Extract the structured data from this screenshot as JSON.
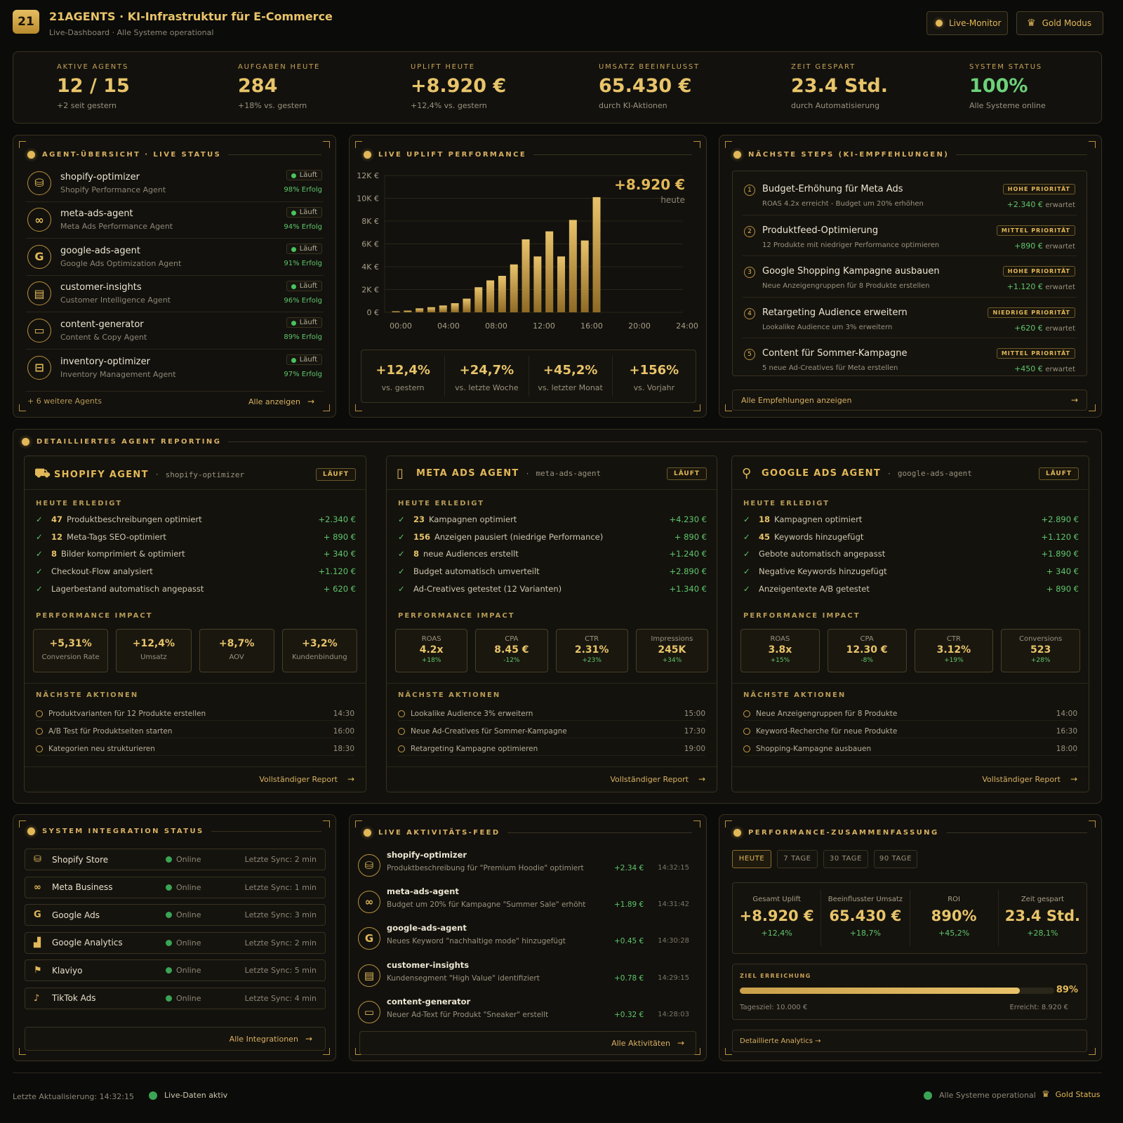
{
  "header": {
    "logo": "21",
    "brand": "21AGENTS",
    "title": "KI-Infrastruktur für E-Commerce",
    "subtitle": "Live-Dashboard · Alle Systeme operational",
    "live_monitor": "Live-Monitor",
    "gold_mode": "Gold Modus"
  },
  "kpis": [
    {
      "label": "AKTIVE AGENTS",
      "value": "12 / 15",
      "sub": "+2 seit gestern"
    },
    {
      "label": "AUFGABEN HEUTE",
      "value": "284",
      "sub": "+18% vs. gestern"
    },
    {
      "label": "UPLIFT HEUTE",
      "value": "+8.920 €",
      "sub": "+12,4% vs. gestern"
    },
    {
      "label": "UMSATZ BEEINFLUSST",
      "value": "65.430 €",
      "sub": "durch KI-Aktionen"
    },
    {
      "label": "ZEIT GESPART",
      "value": "23.4 Std.",
      "sub": "durch Automatisierung"
    },
    {
      "label": "SYSTEM STATUS",
      "value": "100%",
      "sub": "Alle Systeme online"
    }
  ],
  "agents_panel": {
    "title": "AGENT-ÜBERSICHT · LIVE STATUS",
    "agents": [
      {
        "name": "shopify-optimizer",
        "desc": "Shopify Performance Agent",
        "status": "Läuft",
        "success": "98% Erfolg",
        "icon": "shopping-bag-icon"
      },
      {
        "name": "meta-ads-agent",
        "desc": "Meta Ads Performance Agent",
        "status": "Läuft",
        "success": "94% Erfolg",
        "icon": "meta-infinity-icon"
      },
      {
        "name": "google-ads-agent",
        "desc": "Google Ads Optimization Agent",
        "status": "Läuft",
        "success": "91% Erfolg",
        "icon": "google-g-icon"
      },
      {
        "name": "customer-insights",
        "desc": "Customer Intelligence Agent",
        "status": "Läuft",
        "success": "96% Erfolg",
        "icon": "document-icon"
      },
      {
        "name": "content-generator",
        "desc": "Content & Copy Agent",
        "status": "Läuft",
        "success": "89% Erfolg",
        "icon": "chat-bubble-icon"
      },
      {
        "name": "inventory-optimizer",
        "desc": "Inventory Management Agent",
        "status": "Läuft",
        "success": "97% Erfolg",
        "icon": "box-icon"
      }
    ],
    "more": "+ 6 weitere Agents",
    "show_all": "Alle anzeigen"
  },
  "uplift_panel": {
    "title": "LIVE UPLIFT PERFORMANCE",
    "big": "+8.920 €",
    "big_sub": "heute",
    "stats": [
      {
        "value": "+12,4%",
        "label": "vs. gestern"
      },
      {
        "value": "+24,7%",
        "label": "vs. letzte Woche"
      },
      {
        "value": "+45,2%",
        "label": "vs. letzter Monat"
      },
      {
        "value": "+156%",
        "label": "vs. Vorjahr"
      }
    ]
  },
  "chart_data": {
    "type": "bar",
    "x_ticks": [
      "00:00",
      "04:00",
      "08:00",
      "12:00",
      "16:00",
      "20:00",
      "24:00"
    ],
    "y_ticks": [
      "12K €",
      "10K €",
      "8K €",
      "6K €",
      "4K €",
      "2K €",
      "0 €"
    ],
    "ylim": [
      0,
      12000
    ],
    "x": [
      1,
      2,
      3,
      4,
      5,
      6,
      7,
      8,
      9,
      10,
      11,
      12,
      13,
      14,
      15,
      16,
      17,
      18
    ],
    "values": [
      80,
      150,
      350,
      450,
      600,
      800,
      1200,
      2200,
      2800,
      3200,
      4200,
      6400,
      4900,
      7100,
      4900,
      8100,
      6300,
      10100
    ]
  },
  "steps_panel": {
    "title": "NÄCHSTE STEPS (KI-EMPFEHLUNGEN)",
    "steps": [
      {
        "num": "1",
        "title": "Budget-Erhöhung für Meta Ads",
        "desc": "ROAS 4.2x erreicht - Budget um 20% erhöhen",
        "priority": "HOHE PRIORITÄT",
        "amount": "+2.340 €",
        "suffix": "erwartet"
      },
      {
        "num": "2",
        "title": "Produktfeed-Optimierung",
        "desc": "12 Produkte mit niedriger Performance optimieren",
        "priority": "MITTEL PRIORITÄT",
        "amount": "+890 €",
        "suffix": "erwartet"
      },
      {
        "num": "3",
        "title": "Google Shopping Kampagne ausbauen",
        "desc": "Neue Anzeigengruppen für 8 Produkte erstellen",
        "priority": "HOHE PRIORITÄT",
        "amount": "+1.120 €",
        "suffix": "erwartet"
      },
      {
        "num": "4",
        "title": "Retargeting Audience erweitern",
        "desc": "Lookalike Audience um 3% erweitern",
        "priority": "NIEDRIGE PRIORITÄT",
        "amount": "+620 €",
        "suffix": "erwartet"
      },
      {
        "num": "5",
        "title": "Content für Sommer-Kampagne",
        "desc": "5 neue Ad-Creatives für Meta erstellen",
        "priority": "MITTEL PRIORITÄT",
        "amount": "+450 €",
        "suffix": "erwartet"
      }
    ],
    "show_all": "Alle Empfehlungen anzeigen"
  },
  "report": {
    "title": "DETAILLIERTES AGENT REPORTING",
    "done_label": "HEUTE ERLEDIGT",
    "impact_label": "PERFORMANCE IMPACT",
    "next_label": "NÄCHSTE AKTIONEN",
    "full_report": "Vollständiger Report",
    "cards": [
      {
        "title": "SHOPIFY AGENT",
        "id": "shopify-optimizer",
        "status": "LÄUFT",
        "icon": "cart-icon",
        "tasks": [
          {
            "n": "47",
            "t": "Produktbeschreibungen optimiert",
            "v": "+2.340 €"
          },
          {
            "n": "12",
            "t": "Meta-Tags SEO-optimiert",
            "v": "+ 890 €"
          },
          {
            "n": "8",
            "t": "Bilder komprimiert & optimiert",
            "v": "+ 340 €"
          },
          {
            "n": "",
            "t": "Checkout-Flow analysiert",
            "v": "+1.120 €"
          },
          {
            "n": "",
            "t": "Lagerbestand automatisch angepasst",
            "v": "+ 620 €"
          }
        ],
        "impact": [
          {
            "v": "+5,31%",
            "l": "Conversion Rate",
            "c": ""
          },
          {
            "v": "+12,4%",
            "l": "Umsatz",
            "c": ""
          },
          {
            "v": "+8,7%",
            "l": "AOV",
            "c": ""
          },
          {
            "v": "+3,2%",
            "l": "Kundenbindung",
            "c": ""
          }
        ],
        "next": [
          {
            "t": "Produktvarianten für 12 Produkte erstellen",
            "time": "14:30"
          },
          {
            "t": "A/B Test für Produktseiten starten",
            "time": "16:00"
          },
          {
            "t": "Kategorien neu strukturieren",
            "time": "18:30"
          }
        ]
      },
      {
        "title": "META ADS AGENT",
        "id": "meta-ads-agent",
        "status": "LÄUFT",
        "icon": "phone-icon",
        "tasks": [
          {
            "n": "23",
            "t": "Kampagnen optimiert",
            "v": "+4.230 €"
          },
          {
            "n": "156",
            "t": "Anzeigen pausiert (niedrige Performance)",
            "v": "+ 890 €"
          },
          {
            "n": "8",
            "t": "neue Audiences erstellt",
            "v": "+1.240 €"
          },
          {
            "n": "",
            "t": "Budget automatisch umverteilt",
            "v": "+2.890 €"
          },
          {
            "n": "",
            "t": "Ad-Creatives getestet (12 Varianten)",
            "v": "+1.340 €"
          }
        ],
        "impact": [
          {
            "l": "ROAS",
            "v": "4.2x",
            "c": "+18%"
          },
          {
            "l": "CPA",
            "v": "8.45 €",
            "c": "-12%"
          },
          {
            "l": "CTR",
            "v": "2.31%",
            "c": "+23%"
          },
          {
            "l": "Impressions",
            "v": "245K",
            "c": "+34%"
          }
        ],
        "next": [
          {
            "t": "Lookalike Audience 3% erweitern",
            "time": "15:00"
          },
          {
            "t": "Neue Ad-Creatives für Sommer-Kampagne",
            "time": "17:30"
          },
          {
            "t": "Retargeting Kampagne optimieren",
            "time": "19:00"
          }
        ]
      },
      {
        "title": "GOOGLE ADS AGENT",
        "id": "google-ads-agent",
        "status": "LÄUFT",
        "icon": "search-icon",
        "tasks": [
          {
            "n": "18",
            "t": "Kampagnen optimiert",
            "v": "+2.890 €"
          },
          {
            "n": "45",
            "t": "Keywords hinzugefügt",
            "v": "+1.120 €"
          },
          {
            "n": "",
            "t": "Gebote automatisch angepasst",
            "v": "+1.890 €"
          },
          {
            "n": "",
            "t": "Negative Keywords hinzugefügt",
            "v": "+ 340 €"
          },
          {
            "n": "",
            "t": "Anzeigentexte A/B getestet",
            "v": "+ 890 €"
          }
        ],
        "impact": [
          {
            "l": "ROAS",
            "v": "3.8x",
            "c": "+15%"
          },
          {
            "l": "CPA",
            "v": "12.30 €",
            "c": "-8%"
          },
          {
            "l": "CTR",
            "v": "3.12%",
            "c": "+19%"
          },
          {
            "l": "Conversions",
            "v": "523",
            "c": "+28%"
          }
        ],
        "next": [
          {
            "t": "Neue Anzeigengruppen für 8 Produkte",
            "time": "14:00"
          },
          {
            "t": "Keyword-Recherche für neue Produkte",
            "time": "16:30"
          },
          {
            "t": "Shopping-Kampagne ausbauen",
            "time": "18:00"
          }
        ]
      }
    ]
  },
  "integrations": {
    "title": "SYSTEM INTEGRATION STATUS",
    "all": "Alle Integrationen",
    "items": [
      {
        "name": "Shopify Store",
        "status": "Online",
        "sync": "Letzte Sync: 2 min",
        "icon": "shopify-icon"
      },
      {
        "name": "Meta Business",
        "status": "Online",
        "sync": "Letzte Sync: 1 min",
        "icon": "meta-icon"
      },
      {
        "name": "Google Ads",
        "status": "Online",
        "sync": "Letzte Sync: 3 min",
        "icon": "google-icon"
      },
      {
        "name": "Google Analytics",
        "status": "Online",
        "sync": "Letzte Sync: 2 min",
        "icon": "analytics-icon"
      },
      {
        "name": "Klaviyo",
        "status": "Online",
        "sync": "Letzte Sync: 5 min",
        "icon": "klaviyo-flag-icon"
      },
      {
        "name": "TikTok Ads",
        "status": "Online",
        "sync": "Letzte Sync: 4 min",
        "icon": "tiktok-icon"
      }
    ]
  },
  "feed": {
    "title": "LIVE AKTIVITÄTS-FEED",
    "all": "Alle Aktivitäten",
    "items": [
      {
        "agent": "shopify-optimizer",
        "text": "Produktbeschreibung für \"Premium Hoodie\" optimiert",
        "value": "+2.34 €",
        "time": "14:32:15"
      },
      {
        "agent": "meta-ads-agent",
        "text": "Budget um 20% für Kampagne \"Summer Sale\" erhöht",
        "value": "+1.89 €",
        "time": "14:31:42"
      },
      {
        "agent": "google-ads-agent",
        "text": "Neues Keyword \"nachhaltige mode\" hinzugefügt",
        "value": "+0.45 €",
        "time": "14:30:28"
      },
      {
        "agent": "customer-insights",
        "text": "Kundensegment \"High Value\" identifiziert",
        "value": "+0.78 €",
        "time": "14:29:15"
      },
      {
        "agent": "content-generator",
        "text": "Neuer Ad-Text für Produkt \"Sneaker\" erstellt",
        "value": "+0.32 €",
        "time": "14:28:03"
      }
    ]
  },
  "summary": {
    "title": "PERFORMANCE-ZUSAMMENFASSUNG",
    "tabs": [
      "HEUTE",
      "7 TAGE",
      "30 TAGE",
      "90 TAGE"
    ],
    "metrics": [
      {
        "label": "Gesamt Uplift",
        "value": "+8.920 €",
        "change": "+12,4%"
      },
      {
        "label": "Beeinflusster Umsatz",
        "value": "65.430 €",
        "change": "+18,7%"
      },
      {
        "label": "ROI",
        "value": "890%",
        "change": "+45,2%"
      },
      {
        "label": "Zeit gespart",
        "value": "23.4 Std.",
        "change": "+28,1%"
      }
    ],
    "goal_label": "ZIEL ERREICHUNG",
    "goal_percent": "89%",
    "goal_fraction": 0.89,
    "goal_target": "Tagesziel: 10.000 €",
    "goal_reached": "Erreicht: 8.920 €",
    "details": "Detaillierte Analytics →"
  },
  "footer": {
    "updated": "Letzte Aktualisierung: 14:32:15",
    "live": "Live-Daten aktiv",
    "systems": "Alle Systeme operational",
    "gold_status": "Gold Status"
  },
  "colors": {
    "gold": "#e2b858",
    "green": "#5fc66b",
    "bg": "#0b0b09"
  }
}
